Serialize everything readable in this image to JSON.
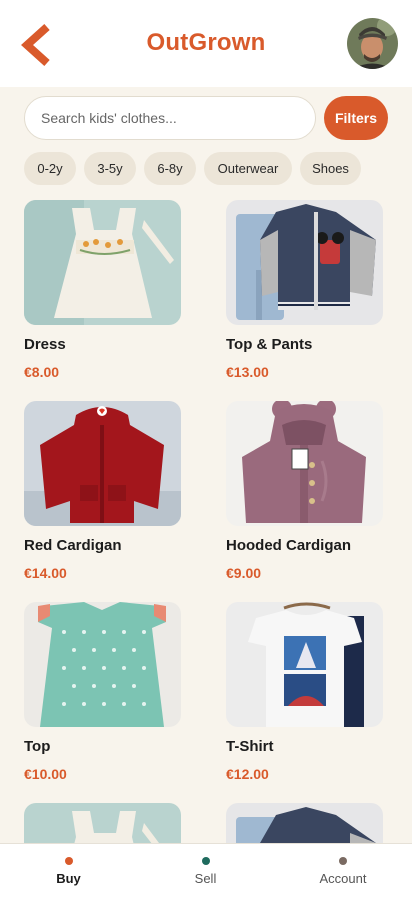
{
  "header": {
    "title": "OutGrown",
    "back_icon": "chevron-left-icon",
    "accent": "#d95a2b"
  },
  "search": {
    "placeholder": "Search kids' clothes...",
    "value": "",
    "filters_label": "Filters"
  },
  "chips": [
    "0-2y",
    "3-5y",
    "6-8y",
    "Outerwear",
    "Shoes"
  ],
  "products": [
    {
      "name": "Dress",
      "price": "€8.00"
    },
    {
      "name": "Top & Pants",
      "price": "€13.00"
    },
    {
      "name": "Red Cardigan",
      "price": "€14.00"
    },
    {
      "name": "Hooded Cardigan",
      "price": "€9.00"
    },
    {
      "name": "Top",
      "price": "€10.00"
    },
    {
      "name": "T-Shirt",
      "price": "€12.00"
    },
    {
      "name": "",
      "price": ""
    },
    {
      "name": "",
      "price": ""
    }
  ],
  "nav": {
    "items": [
      {
        "label": "Buy",
        "dot_color": "#d95a2b",
        "active": true
      },
      {
        "label": "Sell",
        "dot_color": "#1f6b5e",
        "active": false
      },
      {
        "label": "Account",
        "dot_color": "#7a6a62",
        "active": false
      }
    ]
  }
}
